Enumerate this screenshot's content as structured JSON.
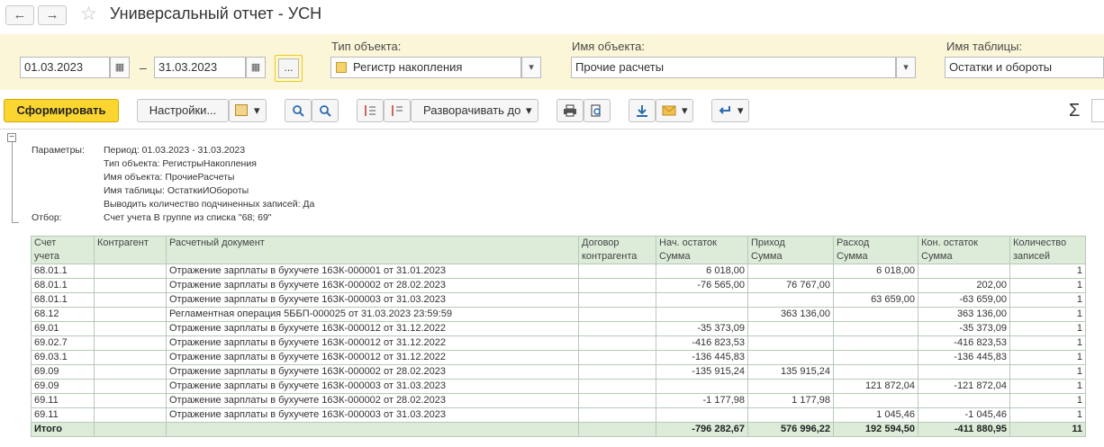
{
  "window": {
    "title": "Универсальный отчет - УСН",
    "back_icon": "←",
    "forward_icon": "→",
    "star_icon": "☆"
  },
  "filters": {
    "date_from": "01.03.2023",
    "date_to": "31.03.2023",
    "dash": "–",
    "calendar_icon": "▦",
    "dots_label": "...",
    "object_type_label": "Тип объекта:",
    "object_type_value": "Регистр накопления",
    "object_name_label": "Имя объекта:",
    "object_name_value": "Прочие расчеты",
    "table_name_label": "Имя таблицы:",
    "table_name_value": "Остатки и обороты",
    "dropdown_icon": "▾"
  },
  "toolbar": {
    "generate_label": "Сформировать",
    "settings_label": "Настройки...",
    "expand_label": "Разворачивать до",
    "sum_icon": "Σ",
    "dropdown_icon": "▾"
  },
  "params": {
    "params_label": "Параметры:",
    "period": "Период: 01.03.2023 - 31.03.2023",
    "object_type": "Тип объекта: РегистрыНакопления",
    "object_name": "Имя объекта: ПрочиеРасчеты",
    "table_name": "Имя таблицы: ОстаткиИОбороты",
    "show_count": "Выводить количество подчиненных записей: Да",
    "filter_label": "Отбор:",
    "filter_value": "Счет учета В группе из списка \"68; 69\""
  },
  "table": {
    "headers": {
      "account": [
        "Счет",
        "учета"
      ],
      "counterparty": "Контрагент",
      "document": "Расчетный документ",
      "contract": [
        "Договор",
        "контрагента"
      ],
      "opening": [
        "Нач. остаток",
        "Сумма"
      ],
      "income": [
        "Приход",
        "Сумма"
      ],
      "expense": [
        "Расход",
        "Сумма"
      ],
      "closing": [
        "Кон. остаток",
        "Сумма"
      ],
      "count": [
        "Количество",
        "записей"
      ]
    },
    "rows": [
      {
        "account": "68.01.1",
        "counterparty": "",
        "document": "Отражение зарплаты в бухучете 16ЗК-000001 от 31.01.2023",
        "contract": "",
        "opening": "6 018,00",
        "income": "",
        "expense": "6 018,00",
        "closing": "",
        "count": "1"
      },
      {
        "account": "68.01.1",
        "counterparty": "",
        "document": "Отражение зарплаты в бухучете 16ЗК-000002 от 28.02.2023",
        "contract": "",
        "opening": "-76 565,00",
        "income": "76 767,00",
        "expense": "",
        "closing": "202,00",
        "count": "1"
      },
      {
        "account": "68.01.1",
        "counterparty": "",
        "document": "Отражение зарплаты в бухучете 16ЗК-000003 от 31.03.2023",
        "contract": "",
        "opening": "",
        "income": "",
        "expense": "63 659,00",
        "closing": "-63 659,00",
        "count": "1"
      },
      {
        "account": "68.12",
        "counterparty": "",
        "document": "Регламентная операция 5ББП-000025 от 31.03.2023 23:59:59",
        "contract": "",
        "opening": "",
        "income": "363 136,00",
        "expense": "",
        "closing": "363 136,00",
        "count": "1"
      },
      {
        "account": "69.01",
        "counterparty": "",
        "document": "Отражение зарплаты в бухучете 16ЗК-000012 от 31.12.2022",
        "contract": "",
        "opening": "-35 373,09",
        "income": "",
        "expense": "",
        "closing": "-35 373,09",
        "count": "1"
      },
      {
        "account": "69.02.7",
        "counterparty": "",
        "document": "Отражение зарплаты в бухучете 16ЗК-000012 от 31.12.2022",
        "contract": "",
        "opening": "-416 823,53",
        "income": "",
        "expense": "",
        "closing": "-416 823,53",
        "count": "1"
      },
      {
        "account": "69.03.1",
        "counterparty": "",
        "document": "Отражение зарплаты в бухучете 16ЗК-000012 от 31.12.2022",
        "contract": "",
        "opening": "-136 445,83",
        "income": "",
        "expense": "",
        "closing": "-136 445,83",
        "count": "1"
      },
      {
        "account": "69.09",
        "counterparty": "",
        "document": "Отражение зарплаты в бухучете 16ЗК-000002 от 28.02.2023",
        "contract": "",
        "opening": "-135 915,24",
        "income": "135 915,24",
        "expense": "",
        "closing": "",
        "count": "1"
      },
      {
        "account": "69.09",
        "counterparty": "",
        "document": "Отражение зарплаты в бухучете 16ЗК-000003 от 31.03.2023",
        "contract": "",
        "opening": "",
        "income": "",
        "expense": "121 872,04",
        "closing": "-121 872,04",
        "count": "1"
      },
      {
        "account": "69.11",
        "counterparty": "",
        "document": "Отражение зарплаты в бухучете 16ЗК-000002 от 28.02.2023",
        "contract": "",
        "opening": "-1 177,98",
        "income": "1 177,98",
        "expense": "",
        "closing": "",
        "count": "1"
      },
      {
        "account": "69.11",
        "counterparty": "",
        "document": "Отражение зарплаты в бухучете 16ЗК-000003 от 31.03.2023",
        "contract": "",
        "opening": "",
        "income": "",
        "expense": "1 045,46",
        "closing": "-1 045,46",
        "count": "1"
      }
    ],
    "total": {
      "label": "Итого",
      "opening": "-796 282,67",
      "income": "576 996,22",
      "expense": "192 594,50",
      "closing": "-411 880,95",
      "count": "11"
    }
  }
}
